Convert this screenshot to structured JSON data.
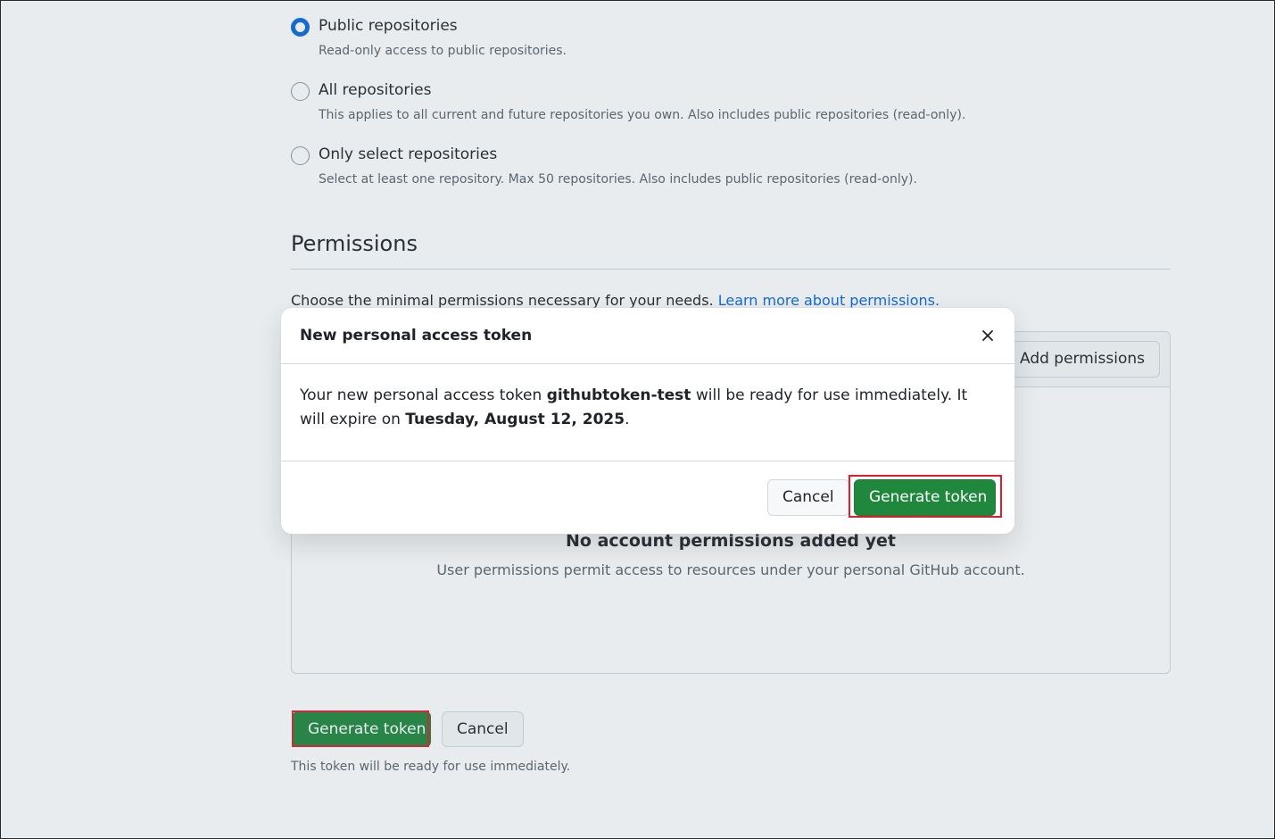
{
  "repo_access": {
    "options": [
      {
        "label": "Public repositories",
        "description": "Read-only access to public repositories.",
        "checked": true
      },
      {
        "label": "All repositories",
        "description": "This applies to all current and future repositories you own. Also includes public repositories (read-only).",
        "checked": false
      },
      {
        "label": "Only select repositories",
        "description": "Select at least one repository. Max 50 repositories. Also includes public repositories (read-only).",
        "checked": false
      }
    ]
  },
  "permissions": {
    "title": "Permissions",
    "description": "Choose the minimal permissions necessary for your needs.",
    "learn_more_link": "Learn more about permissions.",
    "add_permissions_label": "Add permissions",
    "empty_title": "No account permissions added yet",
    "empty_description": "User permissions permit access to resources under your personal GitHub account."
  },
  "actions": {
    "generate_label": "Generate token",
    "cancel_label": "Cancel",
    "hint": "This token will be ready for use immediately."
  },
  "dialog": {
    "title": "New personal access token",
    "body_prefix": "Your new personal access token ",
    "token_name": "githubtoken-test",
    "body_middle": " will be ready for use immediately. It will expire on ",
    "expiry_date": "Tuesday, August 12, 2025",
    "body_suffix": ".",
    "cancel_label": "Cancel",
    "generate_label": "Generate token"
  },
  "colors": {
    "primary_green": "#1f883d",
    "link_blue": "#0969da",
    "highlight_red": "#e01e2b"
  }
}
